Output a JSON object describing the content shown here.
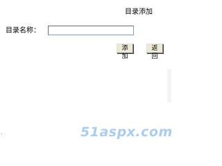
{
  "form": {
    "title": "目录添加",
    "name_label": "目录名称：",
    "name_value": "",
    "add_label": "添加",
    "back_label": "返回"
  },
  "watermark": {
    "text": "51aspx.com",
    "color": "#a9cdef"
  }
}
